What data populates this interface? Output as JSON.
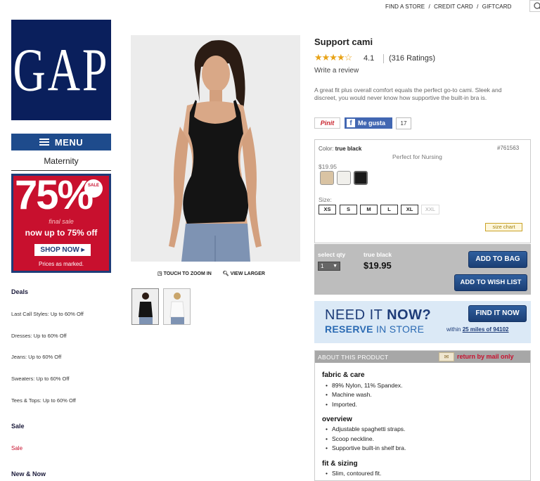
{
  "utility": {
    "find_store": "FIND A STORE",
    "sep1": "/",
    "credit_card": "CREDIT CARD",
    "sep2": "/",
    "giftcard": "GIFTCARD"
  },
  "brand": {
    "logo_text": "GAP",
    "color": "#0a1f5c"
  },
  "nav": {
    "menu_label": "MENU",
    "department": "Maternity"
  },
  "promo": {
    "percent": "75%",
    "badge": "SALE",
    "line1": "final sale",
    "line2": "now up to 75% off",
    "cta": "SHOP NOW ▸",
    "note": "Prices as marked."
  },
  "sidebar": {
    "deals_heading": "Deals",
    "deals": [
      "Last Call Styles: Up to 60% Off",
      "Dresses: Up to 60% Off",
      "Jeans: Up to 60% Off",
      "Sweaters: Up to 60% Off",
      "Tees & Tops: Up to 60% Off"
    ],
    "sale_heading": "Sale",
    "sale_link": "Sale",
    "new_heading": "New & Now"
  },
  "gallery": {
    "zoom": "TOUCH TO ZOOM IN",
    "larger": "VIEW LARGER"
  },
  "product": {
    "name": "Support cami",
    "stars": "★★★★☆",
    "rating_value": "4.1",
    "rating_count": "(316 Ratings)",
    "write_review": "Write a review",
    "description": "A great fit plus overall comfort equals the perfect go-to cami. Sleek and discreet, you would never know how supportive the built-in bra is.",
    "pinit": "Pinit",
    "fb_label": "Me gusta",
    "fb_count": "17"
  },
  "options": {
    "color_label": "Color:",
    "color_value": "true black",
    "sku": "#761563",
    "tagline": "Perfect for Nursing",
    "price": "$19.95",
    "swatches": [
      "#d9c3a3",
      "#f1f0ec",
      "#1a1a1a"
    ],
    "size_label": "Size:",
    "sizes": [
      "XS",
      "S",
      "M",
      "L",
      "XL",
      "XXL"
    ],
    "size_chart": "size chart"
  },
  "purchase": {
    "select_qty": "select qty",
    "qty": "1",
    "color": "true black",
    "price": "$19.95",
    "add_bag": "ADD TO BAG",
    "add_wish": "ADD TO WISH LIST"
  },
  "store": {
    "need": "NEED IT",
    "now": "NOW?",
    "reserve": "RESERVE",
    "in_store": "IN STORE",
    "find_now": "FIND IT NOW",
    "within": "within",
    "radius": "25 miles of 94102"
  },
  "about": {
    "label": "ABOUT THIS PRODUCT",
    "return": "return by mail only",
    "fabric_h": "fabric & care",
    "fabric": [
      "89% Nylon, 11% Spandex.",
      "Machine wash.",
      "Imported."
    ],
    "overview_h": "overview",
    "overview": [
      "Adjustable spaghetti straps.",
      "Scoop neckline.",
      "Supportive built-in shelf bra."
    ],
    "fit_h": "fit & sizing",
    "fit": [
      "Slim, contoured fit."
    ]
  }
}
